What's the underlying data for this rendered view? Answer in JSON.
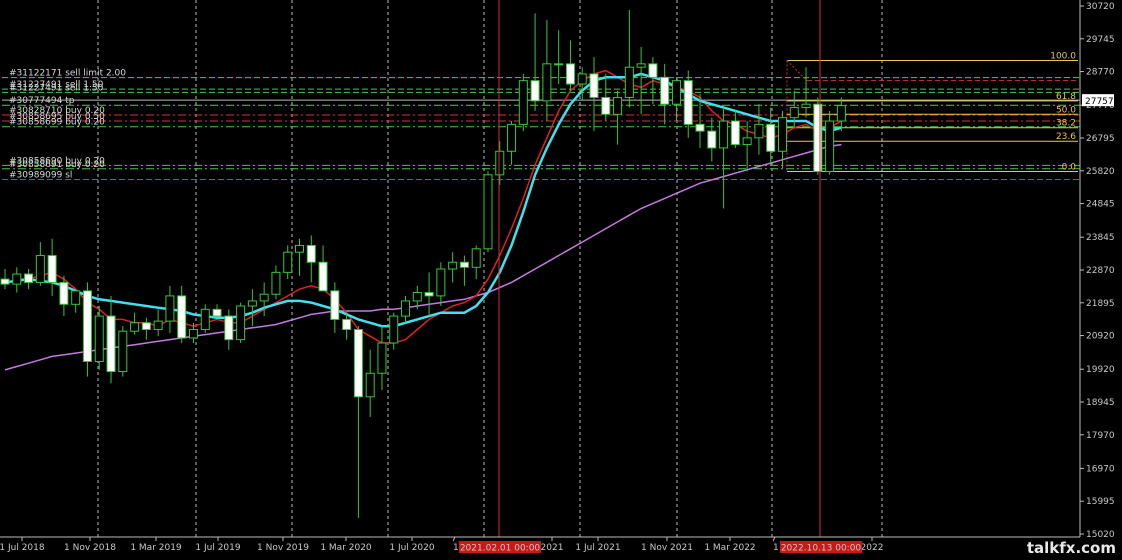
{
  "chart_data": {
    "type": "candlestick",
    "y_axis": {
      "ticks": [
        30720,
        29745,
        28770,
        27770,
        26795,
        25820,
        24845,
        23845,
        22870,
        21895,
        20920,
        19920,
        18945,
        17970,
        16970,
        15995,
        15020
      ],
      "min": 15020,
      "max": 30720
    },
    "x_axis": {
      "labels": [
        "1 Jul 2018",
        "1 Nov 2018",
        "1 Mar 2019",
        "1 Jul 2019",
        "1 Nov 2019",
        "1 Mar 2020",
        "1 Jul 2020",
        "1",
        "2021",
        "1 Jul 2021",
        "1 Nov 2021",
        "1 Mar 2022",
        "1",
        "2022"
      ],
      "highlight_labels": [
        "2021.02.01 00:00",
        "2022.10.13 00:00"
      ]
    },
    "candles": [
      {
        "o": 22600,
        "h": 22900,
        "l": 22300,
        "c": 22450
      },
      {
        "o": 22450,
        "h": 22950,
        "l": 22200,
        "c": 22750
      },
      {
        "o": 22750,
        "h": 22900,
        "l": 22300,
        "c": 22500
      },
      {
        "o": 22500,
        "h": 23700,
        "l": 22400,
        "c": 23300
      },
      {
        "o": 23300,
        "h": 23800,
        "l": 22100,
        "c": 22500
      },
      {
        "o": 22500,
        "h": 22700,
        "l": 21500,
        "c": 21850
      },
      {
        "o": 21850,
        "h": 22300,
        "l": 21600,
        "c": 22250
      },
      {
        "o": 22250,
        "h": 22500,
        "l": 19700,
        "c": 20150
      },
      {
        "o": 20150,
        "h": 21800,
        "l": 19900,
        "c": 21500
      },
      {
        "o": 21500,
        "h": 22100,
        "l": 19500,
        "c": 19850
      },
      {
        "o": 19850,
        "h": 21200,
        "l": 19700,
        "c": 21050
      },
      {
        "o": 21050,
        "h": 21600,
        "l": 20950,
        "c": 21300
      },
      {
        "o": 21300,
        "h": 21450,
        "l": 20800,
        "c": 21100
      },
      {
        "o": 21100,
        "h": 21700,
        "l": 20900,
        "c": 21350
      },
      {
        "o": 21350,
        "h": 22400,
        "l": 21000,
        "c": 22100
      },
      {
        "o": 22100,
        "h": 22400,
        "l": 20700,
        "c": 20850
      },
      {
        "o": 20850,
        "h": 21300,
        "l": 20700,
        "c": 21100
      },
      {
        "o": 21100,
        "h": 21850,
        "l": 21000,
        "c": 21700
      },
      {
        "o": 21700,
        "h": 21850,
        "l": 21550,
        "c": 21500
      },
      {
        "o": 21500,
        "h": 21700,
        "l": 20500,
        "c": 20800
      },
      {
        "o": 20800,
        "h": 21900,
        "l": 20700,
        "c": 21800
      },
      {
        "o": 21800,
        "h": 22300,
        "l": 21200,
        "c": 21950
      },
      {
        "o": 21950,
        "h": 22500,
        "l": 21500,
        "c": 22150
      },
      {
        "o": 22150,
        "h": 23000,
        "l": 22000,
        "c": 22800
      },
      {
        "o": 22800,
        "h": 23600,
        "l": 22600,
        "c": 23400
      },
      {
        "o": 23400,
        "h": 23800,
        "l": 22700,
        "c": 23600
      },
      {
        "o": 23600,
        "h": 23900,
        "l": 22500,
        "c": 23100
      },
      {
        "o": 23100,
        "h": 23600,
        "l": 22400,
        "c": 22250
      },
      {
        "o": 22250,
        "h": 22500,
        "l": 21000,
        "c": 21400
      },
      {
        "o": 21400,
        "h": 21600,
        "l": 20800,
        "c": 21100
      },
      {
        "o": 21100,
        "h": 21200,
        "l": 15500,
        "c": 19100
      },
      {
        "o": 19100,
        "h": 20500,
        "l": 18500,
        "c": 19800
      },
      {
        "o": 19800,
        "h": 21200,
        "l": 19300,
        "c": 20700
      },
      {
        "o": 20700,
        "h": 21600,
        "l": 20500,
        "c": 21500
      },
      {
        "o": 21500,
        "h": 22100,
        "l": 21300,
        "c": 21950
      },
      {
        "o": 21950,
        "h": 22400,
        "l": 21700,
        "c": 22200
      },
      {
        "o": 22200,
        "h": 22800,
        "l": 21500,
        "c": 22100
      },
      {
        "o": 22100,
        "h": 23100,
        "l": 21800,
        "c": 22900
      },
      {
        "o": 22900,
        "h": 23400,
        "l": 22500,
        "c": 23100
      },
      {
        "o": 23100,
        "h": 23300,
        "l": 22400,
        "c": 22950
      },
      {
        "o": 22950,
        "h": 23600,
        "l": 22600,
        "c": 23500
      },
      {
        "o": 23500,
        "h": 25800,
        "l": 23400,
        "c": 25700
      },
      {
        "o": 25700,
        "h": 26700,
        "l": 25400,
        "c": 26400
      },
      {
        "o": 26400,
        "h": 27300,
        "l": 26000,
        "c": 27200
      },
      {
        "o": 27200,
        "h": 28700,
        "l": 27000,
        "c": 28500
      },
      {
        "o": 28500,
        "h": 30500,
        "l": 27600,
        "c": 27900
      },
      {
        "o": 27900,
        "h": 30300,
        "l": 27300,
        "c": 29000
      },
      {
        "o": 29000,
        "h": 30000,
        "l": 28400,
        "c": 29000
      },
      {
        "o": 29000,
        "h": 29700,
        "l": 28200,
        "c": 28400
      },
      {
        "o": 28400,
        "h": 28900,
        "l": 27900,
        "c": 28700
      },
      {
        "o": 28700,
        "h": 29200,
        "l": 27000,
        "c": 28000
      },
      {
        "o": 28000,
        "h": 28700,
        "l": 27300,
        "c": 27500
      },
      {
        "o": 27500,
        "h": 28200,
        "l": 26600,
        "c": 28000
      },
      {
        "o": 28000,
        "h": 30600,
        "l": 27700,
        "c": 28900
      },
      {
        "o": 28900,
        "h": 29500,
        "l": 27500,
        "c": 29000
      },
      {
        "o": 29000,
        "h": 29200,
        "l": 27800,
        "c": 28600
      },
      {
        "o": 28600,
        "h": 29000,
        "l": 27200,
        "c": 27800
      },
      {
        "o": 27800,
        "h": 28600,
        "l": 27300,
        "c": 28500
      },
      {
        "o": 28500,
        "h": 28800,
        "l": 26800,
        "c": 27200
      },
      {
        "o": 27200,
        "h": 28100,
        "l": 26500,
        "c": 27000
      },
      {
        "o": 27000,
        "h": 27400,
        "l": 26100,
        "c": 26500
      },
      {
        "o": 26500,
        "h": 27700,
        "l": 24700,
        "c": 27300
      },
      {
        "o": 27300,
        "h": 27600,
        "l": 26500,
        "c": 26600
      },
      {
        "o": 26600,
        "h": 27300,
        "l": 25800,
        "c": 26800
      },
      {
        "o": 26800,
        "h": 27800,
        "l": 26300,
        "c": 27200
      },
      {
        "o": 27200,
        "h": 27700,
        "l": 26000,
        "c": 26400
      },
      {
        "o": 26400,
        "h": 27600,
        "l": 25900,
        "c": 27400
      },
      {
        "o": 27400,
        "h": 28200,
        "l": 27100,
        "c": 27700
      },
      {
        "o": 27700,
        "h": 28900,
        "l": 27400,
        "c": 27800
      },
      {
        "o": 27800,
        "h": 28000,
        "l": 25700,
        "c": 25800
      },
      {
        "o": 25800,
        "h": 27600,
        "l": 25700,
        "c": 27300
      },
      {
        "o": 27300,
        "h": 28000,
        "l": 27000,
        "c": 27757
      }
    ],
    "ma_red": [
      22450,
      22600,
      22600,
      22700,
      22800,
      22600,
      22300,
      21900,
      21700,
      21400,
      21400,
      21300,
      21300,
      21200,
      21400,
      21300,
      21200,
      21300,
      21400,
      21300,
      21300,
      21500,
      21700,
      21900,
      22100,
      22300,
      22400,
      22300,
      22000,
      21600,
      21100,
      20900,
      20700,
      20700,
      20800,
      21100,
      21400,
      21600,
      21800,
      21900,
      22100,
      22600,
      23300,
      24100,
      25000,
      26000,
      26800,
      27600,
      28200,
      28500,
      28700,
      28800,
      28600,
      28400,
      28300,
      28500,
      28400,
      28300,
      28200,
      28000,
      27600,
      27300,
      27200,
      27000,
      26900,
      26800,
      26900,
      27100,
      27200,
      27000,
      27100,
      27300
    ],
    "ma_cyan": [
      22500,
      22550,
      22600,
      22550,
      22500,
      22400,
      22250,
      22100,
      22000,
      21950,
      21900,
      21850,
      21800,
      21750,
      21700,
      21650,
      21550,
      21500,
      21450,
      21450,
      21500,
      21600,
      21750,
      21850,
      21950,
      21950,
      21900,
      21800,
      21700,
      21550,
      21400,
      21300,
      21200,
      21200,
      21300,
      21400,
      21500,
      21600,
      21600,
      21600,
      21800,
      22200,
      22800,
      23600,
      24600,
      25700,
      26500,
      27200,
      27800,
      28200,
      28500,
      28600,
      28600,
      28600,
      28700,
      28600,
      28500,
      28300,
      28100,
      27900,
      27800,
      27700,
      27600,
      27500,
      27400,
      27300,
      27300,
      27300,
      27300,
      27100,
      27000,
      27100
    ],
    "ma_violet": [
      19900,
      20000,
      20100,
      20200,
      20300,
      20350,
      20400,
      20450,
      20500,
      20550,
      20600,
      20650,
      20700,
      20750,
      20800,
      20850,
      20900,
      20950,
      21000,
      21050,
      21100,
      21150,
      21200,
      21250,
      21350,
      21450,
      21550,
      21600,
      21650,
      21650,
      21650,
      21650,
      21700,
      21700,
      21750,
      21800,
      21850,
      21900,
      21950,
      22000,
      22100,
      22200,
      22350,
      22500,
      22700,
      22900,
      23100,
      23300,
      23500,
      23700,
      23900,
      24100,
      24300,
      24500,
      24700,
      24850,
      25000,
      25150,
      25300,
      25450,
      25550,
      25650,
      25750,
      25850,
      25950,
      26050,
      26150,
      26250,
      26350,
      26450,
      26550,
      26600
    ],
    "fib": {
      "levels": [
        {
          "label": "100.0",
          "value": 29100
        },
        {
          "label": "61.8",
          "value": 27900
        },
        {
          "label": "50.0",
          "value": 27500
        },
        {
          "label": "38.2",
          "value": 27100
        },
        {
          "label": "23.6",
          "value": 26700
        },
        {
          "label": "0.0",
          "value": 25800
        }
      ]
    },
    "current_price": "27757",
    "order_lines": [
      {
        "text": "#31122171 sell limit 2.00",
        "value": 28590,
        "color": "#3fd03f",
        "style": "dash"
      },
      {
        "text": "#31227491 sell 1.50",
        "value": 28250,
        "color": "#3fd03f",
        "style": "dash"
      },
      {
        "text": "#31227491 sell 1.50",
        "value": 28150,
        "color": "#3fd03f",
        "style": "dash"
      },
      {
        "text": "#30777494 tp",
        "value": 27770,
        "color": "#3fd03f",
        "style": "dashdot"
      },
      {
        "text": "#30828710 buy 0.20",
        "value": 27480,
        "color": "#e03030",
        "style": "dashdot"
      },
      {
        "text": "#30858695 buy 0.50",
        "value": 27300,
        "color": "#e03030",
        "style": "dashdot"
      },
      {
        "text": "#30858699 buy 0.20",
        "value": 27130,
        "color": "#3fd03f",
        "style": "dashdot"
      },
      {
        "text": "#30858690 buy 0.20",
        "value": 25980,
        "color": "#3fd03f",
        "style": "dashdot"
      },
      {
        "text": "#30858691 buy 0.20",
        "value": 25880,
        "color": "#3fd03f",
        "style": "dashdot"
      },
      {
        "text": "#30989099 sl",
        "value": 25560,
        "color": "#e03030",
        "style": "dash"
      }
    ]
  },
  "watermark": "talkfx.com"
}
